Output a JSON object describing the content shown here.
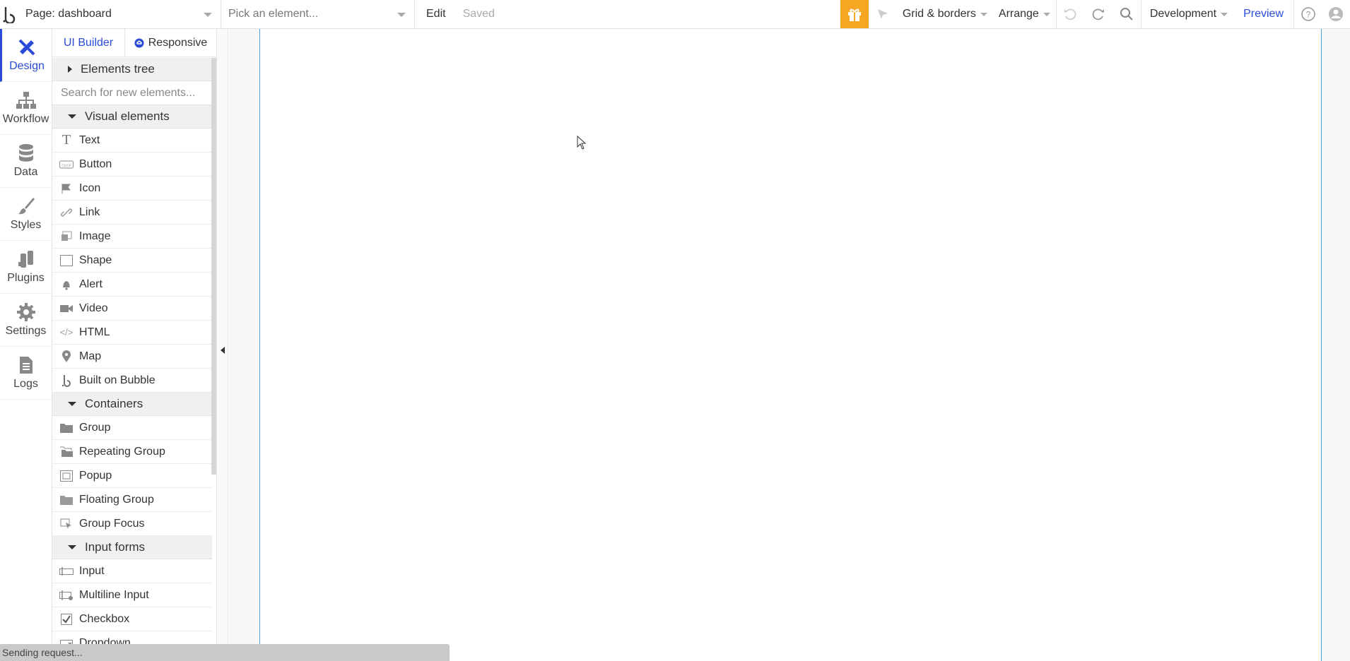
{
  "topbar": {
    "page_label": "Page: dashboard",
    "element_placeholder": "Pick an element...",
    "edit_label": "Edit",
    "saved_label": "Saved",
    "grid_label": "Grid & borders",
    "arrange_label": "Arrange",
    "env_label": "Development",
    "preview_label": "Preview"
  },
  "nav": [
    {
      "label": "Design",
      "icon": "design-icon",
      "active": true
    },
    {
      "label": "Workflow",
      "icon": "workflow-icon"
    },
    {
      "label": "Data",
      "icon": "database-icon"
    },
    {
      "label": "Styles",
      "icon": "brush-icon"
    },
    {
      "label": "Plugins",
      "icon": "plug-icon"
    },
    {
      "label": "Settings",
      "icon": "gear-icon"
    },
    {
      "label": "Logs",
      "icon": "document-icon"
    }
  ],
  "panel": {
    "tab_ui": "UI Builder",
    "tab_responsive": "Responsive",
    "elements_tree": "Elements tree",
    "search_placeholder": "Search for new elements...",
    "visual_heading": "Visual elements",
    "visual": [
      "Text",
      "Button",
      "Icon",
      "Link",
      "Image",
      "Shape",
      "Alert",
      "Video",
      "HTML",
      "Map",
      "Built on Bubble"
    ],
    "containers_heading": "Containers",
    "containers": [
      "Group",
      "Repeating Group",
      "Popup",
      "Floating Group",
      "Group Focus"
    ],
    "inputs_heading": "Input forms",
    "inputs": [
      "Input",
      "Multiline Input",
      "Checkbox",
      "Dropdown"
    ]
  },
  "status": "Sending request...",
  "colors": {
    "accent": "#2a4bd7",
    "gift": "#f5a623",
    "canvas_border": "#4aa3df"
  }
}
